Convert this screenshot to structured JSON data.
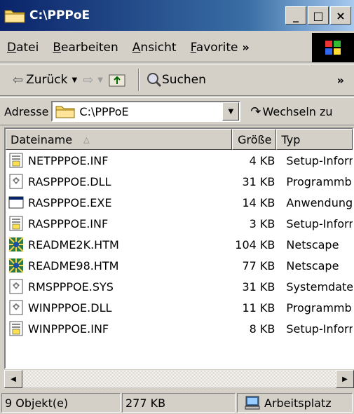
{
  "window": {
    "title": "C:\\PPPoE",
    "minimize": "_",
    "maximize": "□",
    "close": "×"
  },
  "menu": [
    {
      "key": "D",
      "rest": "atei"
    },
    {
      "key": "B",
      "rest": "earbeiten"
    },
    {
      "key": "A",
      "rest": "nsicht"
    },
    {
      "key": "F",
      "rest": "avorite"
    }
  ],
  "menu_overflow": "»",
  "toolbar": {
    "back_label": "Zurück",
    "search_label": "Suchen",
    "overflow": "»"
  },
  "address": {
    "label": "Adresse",
    "value": "C:\\PPPoE",
    "go_label": "Wechseln zu"
  },
  "columns": {
    "name": "Dateiname",
    "size": "Größe",
    "type": "Typ"
  },
  "files": [
    {
      "name": "NETPPPOE.INF",
      "size": "4 KB",
      "type": "Setup-Informationen",
      "icon": "inf"
    },
    {
      "name": "RASPPPOE.DLL",
      "size": "31 KB",
      "type": "Programmbibliothek",
      "icon": "dll"
    },
    {
      "name": "RASPPPOE.EXE",
      "size": "14 KB",
      "type": "Anwendung",
      "icon": "exe"
    },
    {
      "name": "RASPPPOE.INF",
      "size": "3 KB",
      "type": "Setup-Informationen",
      "icon": "inf"
    },
    {
      "name": "README2K.HTM",
      "size": "104 KB",
      "type": "Netscape",
      "icon": "htm"
    },
    {
      "name": "README98.HTM",
      "size": "77 KB",
      "type": "Netscape",
      "icon": "htm"
    },
    {
      "name": "RMSPPPOE.SYS",
      "size": "31 KB",
      "type": "Systemdatei",
      "icon": "dll"
    },
    {
      "name": "WINPPPOE.DLL",
      "size": "11 KB",
      "type": "Programmbibliothek",
      "icon": "dll"
    },
    {
      "name": "WINPPPOE.INF",
      "size": "8 KB",
      "type": "Setup-Informationen",
      "icon": "inf"
    }
  ],
  "status": {
    "count": "9 Objekt(e)",
    "size": "277 KB",
    "zone": "Arbeitsplatz"
  }
}
